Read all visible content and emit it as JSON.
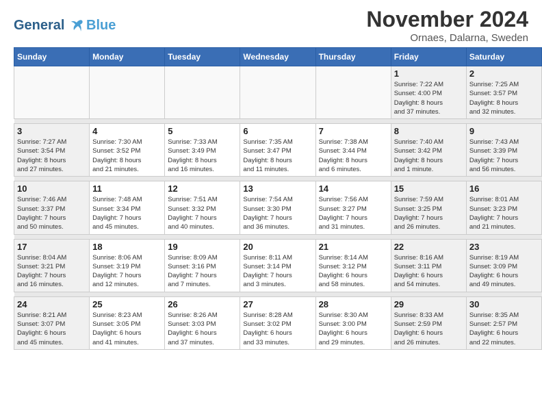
{
  "header": {
    "logo_line1": "General",
    "logo_line2": "Blue",
    "month_year": "November 2024",
    "location": "Ornaes, Dalarna, Sweden"
  },
  "weekdays": [
    "Sunday",
    "Monday",
    "Tuesday",
    "Wednesday",
    "Thursday",
    "Friday",
    "Saturday"
  ],
  "weeks": [
    [
      {
        "day": "",
        "info": "",
        "empty": true
      },
      {
        "day": "",
        "info": "",
        "empty": true
      },
      {
        "day": "",
        "info": "",
        "empty": true
      },
      {
        "day": "",
        "info": "",
        "empty": true
      },
      {
        "day": "",
        "info": "",
        "empty": true
      },
      {
        "day": "1",
        "info": "Sunrise: 7:22 AM\nSunset: 4:00 PM\nDaylight: 8 hours\nand 37 minutes.",
        "weekend": true
      },
      {
        "day": "2",
        "info": "Sunrise: 7:25 AM\nSunset: 3:57 PM\nDaylight: 8 hours\nand 32 minutes.",
        "weekend": true
      }
    ],
    [
      {
        "day": "3",
        "info": "Sunrise: 7:27 AM\nSunset: 3:54 PM\nDaylight: 8 hours\nand 27 minutes.",
        "weekend": true
      },
      {
        "day": "4",
        "info": "Sunrise: 7:30 AM\nSunset: 3:52 PM\nDaylight: 8 hours\nand 21 minutes."
      },
      {
        "day": "5",
        "info": "Sunrise: 7:33 AM\nSunset: 3:49 PM\nDaylight: 8 hours\nand 16 minutes."
      },
      {
        "day": "6",
        "info": "Sunrise: 7:35 AM\nSunset: 3:47 PM\nDaylight: 8 hours\nand 11 minutes."
      },
      {
        "day": "7",
        "info": "Sunrise: 7:38 AM\nSunset: 3:44 PM\nDaylight: 8 hours\nand 6 minutes."
      },
      {
        "day": "8",
        "info": "Sunrise: 7:40 AM\nSunset: 3:42 PM\nDaylight: 8 hours\nand 1 minute.",
        "weekend": true
      },
      {
        "day": "9",
        "info": "Sunrise: 7:43 AM\nSunset: 3:39 PM\nDaylight: 7 hours\nand 56 minutes.",
        "weekend": true
      }
    ],
    [
      {
        "day": "10",
        "info": "Sunrise: 7:46 AM\nSunset: 3:37 PM\nDaylight: 7 hours\nand 50 minutes.",
        "weekend": true
      },
      {
        "day": "11",
        "info": "Sunrise: 7:48 AM\nSunset: 3:34 PM\nDaylight: 7 hours\nand 45 minutes."
      },
      {
        "day": "12",
        "info": "Sunrise: 7:51 AM\nSunset: 3:32 PM\nDaylight: 7 hours\nand 40 minutes."
      },
      {
        "day": "13",
        "info": "Sunrise: 7:54 AM\nSunset: 3:30 PM\nDaylight: 7 hours\nand 36 minutes."
      },
      {
        "day": "14",
        "info": "Sunrise: 7:56 AM\nSunset: 3:27 PM\nDaylight: 7 hours\nand 31 minutes."
      },
      {
        "day": "15",
        "info": "Sunrise: 7:59 AM\nSunset: 3:25 PM\nDaylight: 7 hours\nand 26 minutes.",
        "weekend": true
      },
      {
        "day": "16",
        "info": "Sunrise: 8:01 AM\nSunset: 3:23 PM\nDaylight: 7 hours\nand 21 minutes.",
        "weekend": true
      }
    ],
    [
      {
        "day": "17",
        "info": "Sunrise: 8:04 AM\nSunset: 3:21 PM\nDaylight: 7 hours\nand 16 minutes.",
        "weekend": true
      },
      {
        "day": "18",
        "info": "Sunrise: 8:06 AM\nSunset: 3:19 PM\nDaylight: 7 hours\nand 12 minutes."
      },
      {
        "day": "19",
        "info": "Sunrise: 8:09 AM\nSunset: 3:16 PM\nDaylight: 7 hours\nand 7 minutes."
      },
      {
        "day": "20",
        "info": "Sunrise: 8:11 AM\nSunset: 3:14 PM\nDaylight: 7 hours\nand 3 minutes."
      },
      {
        "day": "21",
        "info": "Sunrise: 8:14 AM\nSunset: 3:12 PM\nDaylight: 6 hours\nand 58 minutes."
      },
      {
        "day": "22",
        "info": "Sunrise: 8:16 AM\nSunset: 3:11 PM\nDaylight: 6 hours\nand 54 minutes.",
        "weekend": true
      },
      {
        "day": "23",
        "info": "Sunrise: 8:19 AM\nSunset: 3:09 PM\nDaylight: 6 hours\nand 49 minutes.",
        "weekend": true
      }
    ],
    [
      {
        "day": "24",
        "info": "Sunrise: 8:21 AM\nSunset: 3:07 PM\nDaylight: 6 hours\nand 45 minutes.",
        "weekend": true
      },
      {
        "day": "25",
        "info": "Sunrise: 8:23 AM\nSunset: 3:05 PM\nDaylight: 6 hours\nand 41 minutes."
      },
      {
        "day": "26",
        "info": "Sunrise: 8:26 AM\nSunset: 3:03 PM\nDaylight: 6 hours\nand 37 minutes."
      },
      {
        "day": "27",
        "info": "Sunrise: 8:28 AM\nSunset: 3:02 PM\nDaylight: 6 hours\nand 33 minutes."
      },
      {
        "day": "28",
        "info": "Sunrise: 8:30 AM\nSunset: 3:00 PM\nDaylight: 6 hours\nand 29 minutes."
      },
      {
        "day": "29",
        "info": "Sunrise: 8:33 AM\nSunset: 2:59 PM\nDaylight: 6 hours\nand 26 minutes.",
        "weekend": true
      },
      {
        "day": "30",
        "info": "Sunrise: 8:35 AM\nSunset: 2:57 PM\nDaylight: 6 hours\nand 22 minutes.",
        "weekend": true
      }
    ]
  ]
}
